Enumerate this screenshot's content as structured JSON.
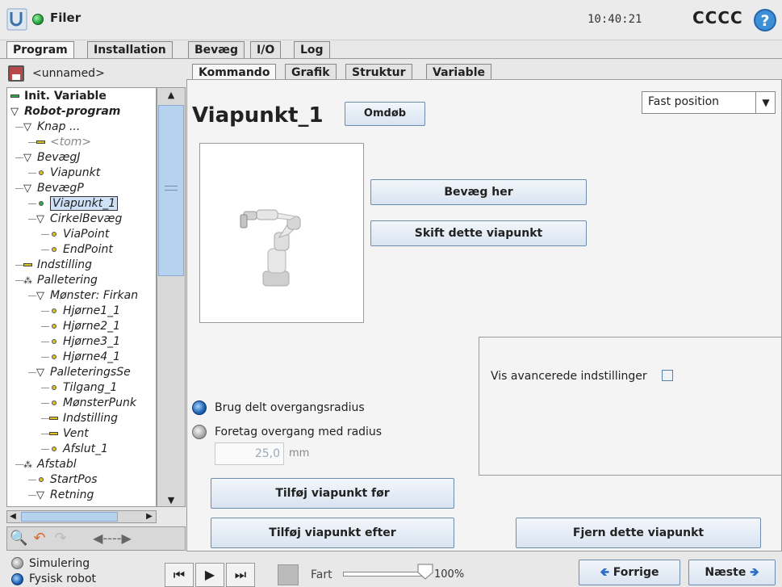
{
  "header": {
    "title": "Filer",
    "clock": "10:40:21",
    "robot_name": "CCCC",
    "help": "?"
  },
  "top_tabs": [
    "Program",
    "Installation",
    "Bevæg",
    "I/O",
    "Log"
  ],
  "program_name": "<unnamed>",
  "sub_tabs": [
    "Kommando",
    "Grafik",
    "Struktur",
    "Variable"
  ],
  "tree": [
    {
      "label": "Init. Variable",
      "indent": 0,
      "icon": "bar",
      "style": "bold"
    },
    {
      "label": "Robot-program",
      "indent": 0,
      "icon": "triangle",
      "style": "bold italic"
    },
    {
      "label": "Knap ...",
      "indent": 1,
      "icon": "triangle",
      "style": "italic"
    },
    {
      "label": "<tom>",
      "indent": 2,
      "icon": "bar",
      "style": "italic muted"
    },
    {
      "label": "BevægJ",
      "indent": 1,
      "icon": "triangle",
      "style": "italic"
    },
    {
      "label": "Viapunkt",
      "indent": 2,
      "icon": "dot",
      "style": "italic"
    },
    {
      "label": "BevægP",
      "indent": 1,
      "icon": "triangle",
      "style": "italic"
    },
    {
      "label": "Viapunkt_1",
      "indent": 2,
      "icon": "dot",
      "style": "selected"
    },
    {
      "label": "CirkelBevæg",
      "indent": 2,
      "icon": "triangle",
      "style": "italic"
    },
    {
      "label": "ViaPoint",
      "indent": 3,
      "icon": "dot",
      "style": "italic"
    },
    {
      "label": "EndPoint",
      "indent": 3,
      "icon": "dot",
      "style": "italic"
    },
    {
      "label": "Indstilling",
      "indent": 1,
      "icon": "bar",
      "style": "italic"
    },
    {
      "label": "Palletering",
      "indent": 1,
      "icon": "pallet",
      "style": "italic"
    },
    {
      "label": "Mønster: Firkan",
      "indent": 2,
      "icon": "triangle",
      "style": "italic"
    },
    {
      "label": "Hjørne1_1",
      "indent": 3,
      "icon": "dot",
      "style": "italic"
    },
    {
      "label": "Hjørne2_1",
      "indent": 3,
      "icon": "dot",
      "style": "italic"
    },
    {
      "label": "Hjørne3_1",
      "indent": 3,
      "icon": "dot",
      "style": "italic"
    },
    {
      "label": "Hjørne4_1",
      "indent": 3,
      "icon": "dot",
      "style": "italic"
    },
    {
      "label": "PalleteringsSe",
      "indent": 2,
      "icon": "triangle",
      "style": "italic"
    },
    {
      "label": "Tilgang_1",
      "indent": 3,
      "icon": "dot",
      "style": "italic"
    },
    {
      "label": "MønsterPunk",
      "indent": 3,
      "icon": "dot",
      "style": "italic"
    },
    {
      "label": "Indstilling",
      "indent": 3,
      "icon": "bar",
      "style": "italic"
    },
    {
      "label": "Vent",
      "indent": 3,
      "icon": "bar",
      "style": "italic"
    },
    {
      "label": "Afslut_1",
      "indent": 3,
      "icon": "dot",
      "style": "italic"
    },
    {
      "label": "Afstabl",
      "indent": 1,
      "icon": "pallet",
      "style": "italic"
    },
    {
      "label": "StartPos",
      "indent": 2,
      "icon": "dot",
      "style": "italic"
    },
    {
      "label": "Retning",
      "indent": 2,
      "icon": "triangle",
      "style": "italic"
    }
  ],
  "main": {
    "title": "Viapunkt_1",
    "rename": "Omdøb",
    "position_select": "Fast position",
    "move_here": "Bevæg her",
    "change_waypoint": "Skift dette viapunkt",
    "advanced_label": "Vis avancerede indstillinger",
    "shared_radius": "Brug delt overgangsradius",
    "custom_radius": "Foretag overgang med radius",
    "radius_value": "25,0",
    "radius_unit": "mm",
    "add_before": "Tilføj viapunkt før",
    "add_after": "Tilføj viapunkt efter",
    "remove": "Fjern dette viapunkt"
  },
  "footer": {
    "simulation": "Simulering",
    "real_robot": "Fysisk robot",
    "speed_label": "Fart",
    "speed_value": "100%",
    "speed_level": 1.0,
    "prev": "Forrige",
    "next": "Næste"
  },
  "colors": {
    "accent": "#3d8fd8",
    "selected_bg": "#cfe1f7",
    "button_border": "#6e8dae"
  }
}
